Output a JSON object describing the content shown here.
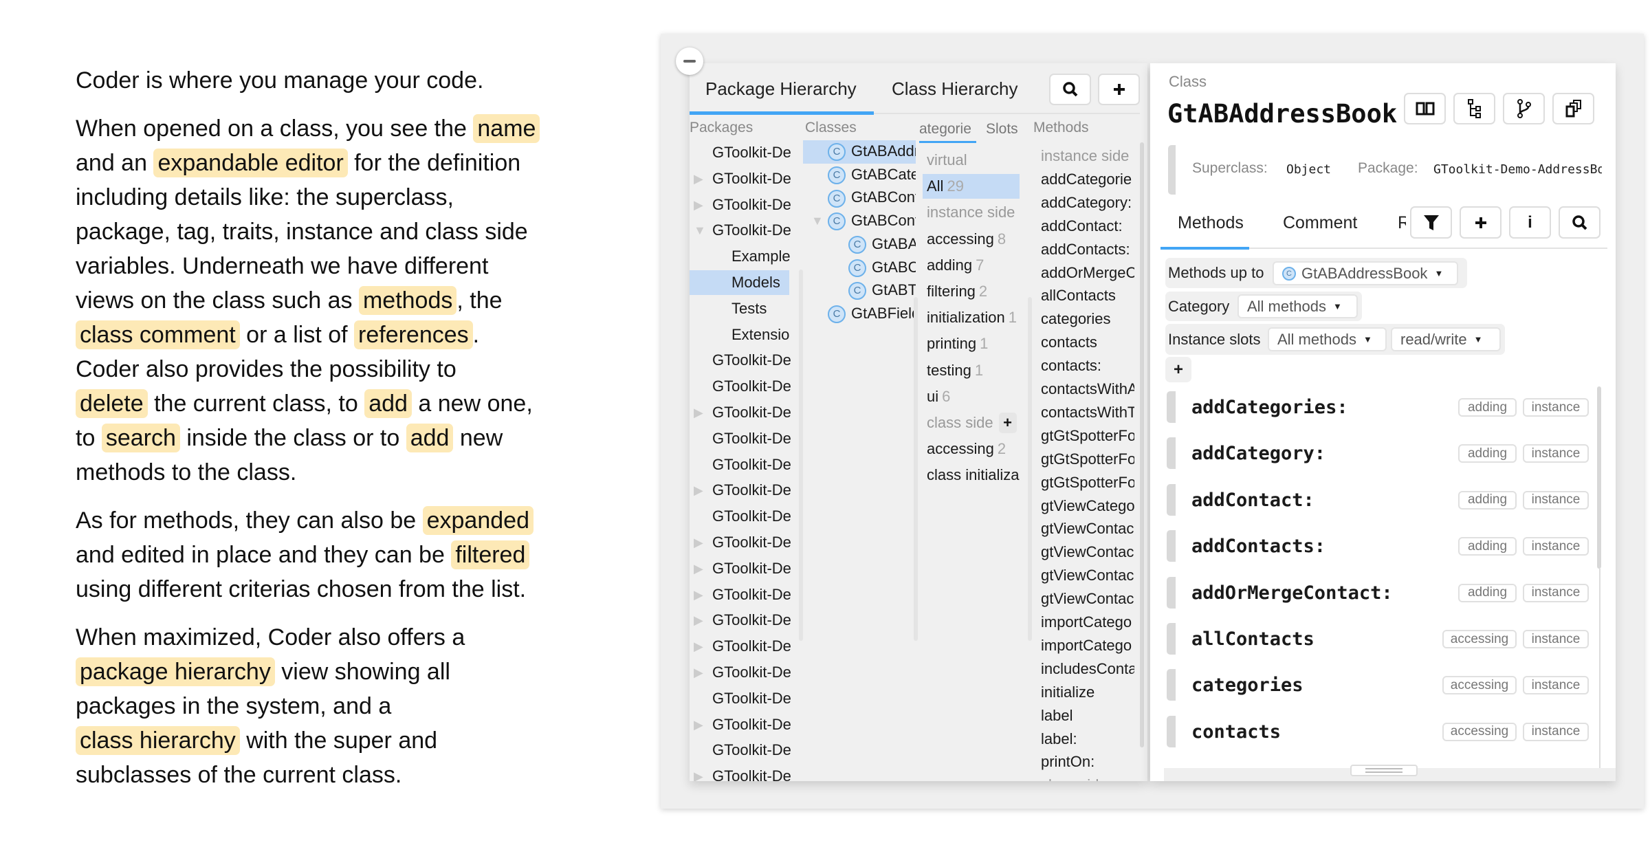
{
  "explanation": {
    "paragraphs": [
      [
        [
          {
            "text": "Coder is where you manage your code."
          }
        ]
      ],
      [
        [
          {
            "text": "When opened on a class, you see the "
          },
          {
            "text": "name",
            "highlight": true
          }
        ],
        [
          {
            "text": "and an "
          },
          {
            "text": "expandable editor",
            "highlight": true
          },
          {
            "text": " for the definition"
          }
        ],
        [
          {
            "text": "including details like: the superclass,"
          }
        ],
        [
          {
            "text": "package, tag, traits, instance and class side"
          }
        ],
        [
          {
            "text": "variables. Underneath we have different"
          }
        ],
        [
          {
            "text": "views on the class such as "
          },
          {
            "text": "methods",
            "highlight": true
          },
          {
            "text": ", the"
          }
        ],
        [
          {
            "text": "class comment",
            "highlight": true
          },
          {
            "text": " or a list of "
          },
          {
            "text": "references",
            "highlight": true
          },
          {
            "text": "."
          }
        ],
        [
          {
            "text": "Coder also provides the possibility to"
          }
        ],
        [
          {
            "text": "delete",
            "highlight": true
          },
          {
            "text": " the current class, to "
          },
          {
            "text": "add",
            "highlight": true
          },
          {
            "text": " a new one,"
          }
        ],
        [
          {
            "text": "to "
          },
          {
            "text": "search",
            "highlight": true
          },
          {
            "text": " inside the class or to "
          },
          {
            "text": "add",
            "highlight": true
          },
          {
            "text": " new"
          }
        ],
        [
          {
            "text": "methods to the class."
          }
        ]
      ],
      [
        [
          {
            "text": "As for methods, they can also be "
          },
          {
            "text": "expanded",
            "highlight": true
          }
        ],
        [
          {
            "text": "and edited in place and they can be "
          },
          {
            "text": "filtered",
            "highlight": true
          }
        ],
        [
          {
            "text": "using different criterias chosen from the list."
          }
        ]
      ],
      [
        [
          {
            "text": "When maximized, Coder also offers a"
          }
        ],
        [
          {
            "text": "package hierarchy",
            "highlight": true
          },
          {
            "text": " view showing all"
          }
        ],
        [
          {
            "text": "packages in the system, and a"
          }
        ],
        [
          {
            "text": "class hierarchy",
            "highlight": true
          },
          {
            "text": " with the super and"
          }
        ],
        [
          {
            "text": "subclasses of the current class."
          }
        ]
      ]
    ],
    "highlight_color": "#fde9b6"
  },
  "navigator": {
    "tabs": [
      {
        "label": "Package Hierarchy",
        "active": true
      },
      {
        "label": "Class Hierarchy",
        "active": false
      }
    ],
    "search_icon": "search-icon",
    "add_icon": "plus-icon",
    "packages_header": "Packages",
    "classes_header": "Classes",
    "methods_header": "Methods",
    "category_tabs": [
      {
        "label": "ategorie",
        "active": true
      },
      {
        "label": "Slots",
        "active": false
      }
    ],
    "packages": [
      {
        "label": "GToolkit-De",
        "arrow": "none"
      },
      {
        "label": "GToolkit-De",
        "arrow": "right"
      },
      {
        "label": "GToolkit-De",
        "arrow": "right"
      },
      {
        "label": "GToolkit-De",
        "arrow": "down"
      },
      {
        "label": "Example",
        "indent": true
      },
      {
        "label": "Models",
        "indent": true,
        "selected": true
      },
      {
        "label": "Tests",
        "indent": true
      },
      {
        "label": "Extensio",
        "indent": true
      },
      {
        "label": "GToolkit-De",
        "arrow": "none"
      },
      {
        "label": "GToolkit-De",
        "arrow": "none"
      },
      {
        "label": "GToolkit-De",
        "arrow": "right"
      },
      {
        "label": "GToolkit-De",
        "arrow": "none"
      },
      {
        "label": "GToolkit-De",
        "arrow": "none"
      },
      {
        "label": "GToolkit-De",
        "arrow": "right"
      },
      {
        "label": "GToolkit-De",
        "arrow": "none"
      },
      {
        "label": "GToolkit-De",
        "arrow": "right"
      },
      {
        "label": "GToolkit-De",
        "arrow": "right"
      },
      {
        "label": "GToolkit-De",
        "arrow": "right"
      },
      {
        "label": "GToolkit-De",
        "arrow": "right"
      },
      {
        "label": "GToolkit-De",
        "arrow": "right"
      },
      {
        "label": "GToolkit-De",
        "arrow": "right"
      },
      {
        "label": "GToolkit-De",
        "arrow": "none"
      },
      {
        "label": "GToolkit-De",
        "arrow": "right"
      },
      {
        "label": "GToolkit-De",
        "arrow": "none"
      },
      {
        "label": "GToolkit-De",
        "arrow": "right"
      }
    ],
    "classes": [
      {
        "label": "GtABAddr",
        "selected": true
      },
      {
        "label": "GtABCate"
      },
      {
        "label": "GtABCont"
      },
      {
        "label": "GtABCont",
        "arrow": "down"
      },
      {
        "label": "GtABAc",
        "indent": true
      },
      {
        "label": "GtABCc",
        "indent": true
      },
      {
        "label": "GtABTe",
        "indent": true
      },
      {
        "label": "GtABField"
      }
    ],
    "categories": [
      {
        "label": "virtual",
        "muted": true
      },
      {
        "label": "All",
        "count": "29",
        "selected": true
      },
      {
        "label": "instance side",
        "muted": true
      },
      {
        "label": "accessing",
        "count": "8"
      },
      {
        "label": "adding",
        "count": "7"
      },
      {
        "label": "filtering",
        "count": "2"
      },
      {
        "label": "initialization",
        "count": "1"
      },
      {
        "label": "printing",
        "count": "1"
      },
      {
        "label": "testing",
        "count": "1"
      },
      {
        "label": "ui",
        "count": "6"
      },
      {
        "label": "class side",
        "muted": true,
        "add": "+"
      },
      {
        "label": "accessing",
        "count": "2"
      },
      {
        "label": "class initializa"
      }
    ],
    "methods": [
      {
        "label": "instance side",
        "muted": true
      },
      {
        "label": "addCategorie"
      },
      {
        "label": "addCategory:"
      },
      {
        "label": "addContact:"
      },
      {
        "label": "addContacts:"
      },
      {
        "label": "addOrMergeC"
      },
      {
        "label": "allContacts"
      },
      {
        "label": "categories"
      },
      {
        "label": "contacts"
      },
      {
        "label": "contacts:"
      },
      {
        "label": "contactsWithA"
      },
      {
        "label": "contactsWithT"
      },
      {
        "label": "gtGtSpotterFo"
      },
      {
        "label": "gtGtSpotterFo"
      },
      {
        "label": "gtGtSpotterFo"
      },
      {
        "label": "gtViewCatego"
      },
      {
        "label": "gtViewContac"
      },
      {
        "label": "gtViewContac"
      },
      {
        "label": "gtViewContac"
      },
      {
        "label": "gtViewContac"
      },
      {
        "label": "importCatego"
      },
      {
        "label": "importCatego"
      },
      {
        "label": "includesConta"
      },
      {
        "label": "initialize"
      },
      {
        "label": "label"
      },
      {
        "label": "label:"
      },
      {
        "label": "printOn:"
      },
      {
        "label": "class side",
        "muted": true
      }
    ]
  },
  "class_panel": {
    "kind_label": "Class",
    "class_name": "GtABAddressBook",
    "header_buttons": [
      "book-icon",
      "hierarchy-icon",
      "branch-icon",
      "copy-icon"
    ],
    "superclass_label": "Superclass:",
    "superclass": "Object",
    "package_label": "Package:",
    "package": "GToolkit-Demo-AddressBook",
    "tabs": [
      {
        "label": "Methods",
        "active": true
      },
      {
        "label": "Comment",
        "active": false
      },
      {
        "label": "R",
        "active": false
      }
    ],
    "tab_buttons": [
      "filter-icon",
      "plus-icon",
      "info-icon",
      "search-icon"
    ],
    "filters": {
      "methods_up_to_label": "Methods up to",
      "methods_up_to_value": "GtABAddressBook",
      "category_label": "Category",
      "category_value": "All methods",
      "instance_slots_label": "Instance slots",
      "instance_slots_value": "All methods",
      "access_value": "read/write",
      "add_filter": "+"
    },
    "method_cards": [
      {
        "name": "addCategories:",
        "category": "adding",
        "side": "instance"
      },
      {
        "name": "addCategory:",
        "category": "adding",
        "side": "instance"
      },
      {
        "name": "addContact:",
        "category": "adding",
        "side": "instance"
      },
      {
        "name": "addContacts:",
        "category": "adding",
        "side": "instance"
      },
      {
        "name": "addOrMergeContact:",
        "category": "adding",
        "side": "instance"
      },
      {
        "name": "allContacts",
        "category": "accessing",
        "side": "instance"
      },
      {
        "name": "categories",
        "category": "accessing",
        "side": "instance"
      },
      {
        "name": "contacts",
        "category": "accessing",
        "side": "instance"
      }
    ]
  },
  "colors": {
    "accent": "#42a5f5",
    "selection": "#c5dbf5",
    "highlight": "#fde9b6"
  }
}
